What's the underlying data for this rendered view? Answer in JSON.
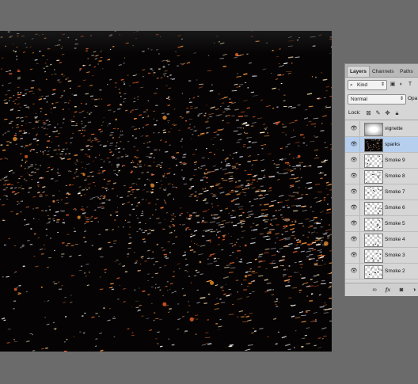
{
  "layers_panel": {
    "tabs": [
      {
        "label": "Layers",
        "active": true
      },
      {
        "label": "Channels",
        "active": false
      },
      {
        "label": "Paths",
        "active": false
      }
    ],
    "filter": {
      "kind_label": "Kind",
      "search_icon": "magnifier-icon"
    },
    "blend_mode": "Normal",
    "opacity_label": "Opa",
    "lock_label": "Lock:",
    "layers": [
      {
        "name": "vignette",
        "visible": true,
        "selected": false,
        "thumb": "vignette"
      },
      {
        "name": "sparks",
        "visible": true,
        "selected": true,
        "thumb": "sparks"
      },
      {
        "name": "Smoke 9",
        "visible": true,
        "selected": false,
        "thumb": "transparent"
      },
      {
        "name": "Smoke 8",
        "visible": true,
        "selected": false,
        "thumb": "transparent"
      },
      {
        "name": "Smoke 7",
        "visible": true,
        "selected": false,
        "thumb": "transparent"
      },
      {
        "name": "Smoke 6",
        "visible": true,
        "selected": false,
        "thumb": "transparent"
      },
      {
        "name": "Smoke 5",
        "visible": true,
        "selected": false,
        "thumb": "transparent"
      },
      {
        "name": "Smoke 4",
        "visible": true,
        "selected": false,
        "thumb": "transparent"
      },
      {
        "name": "Smoke 3",
        "visible": true,
        "selected": false,
        "thumb": "transparent"
      },
      {
        "name": "Smoke 2",
        "visible": true,
        "selected": false,
        "thumb": "transparent"
      }
    ],
    "footer_icons": [
      "link-layers-icon",
      "fx-icon",
      "layer-mask-icon",
      "adjustment-layer-icon"
    ]
  },
  "canvas": {
    "background": "#050303",
    "spark_colors": [
      "#ffe2b0",
      "#ff9a40",
      "#ffffff",
      "#ff6a2a",
      "#d8d8e8"
    ]
  }
}
